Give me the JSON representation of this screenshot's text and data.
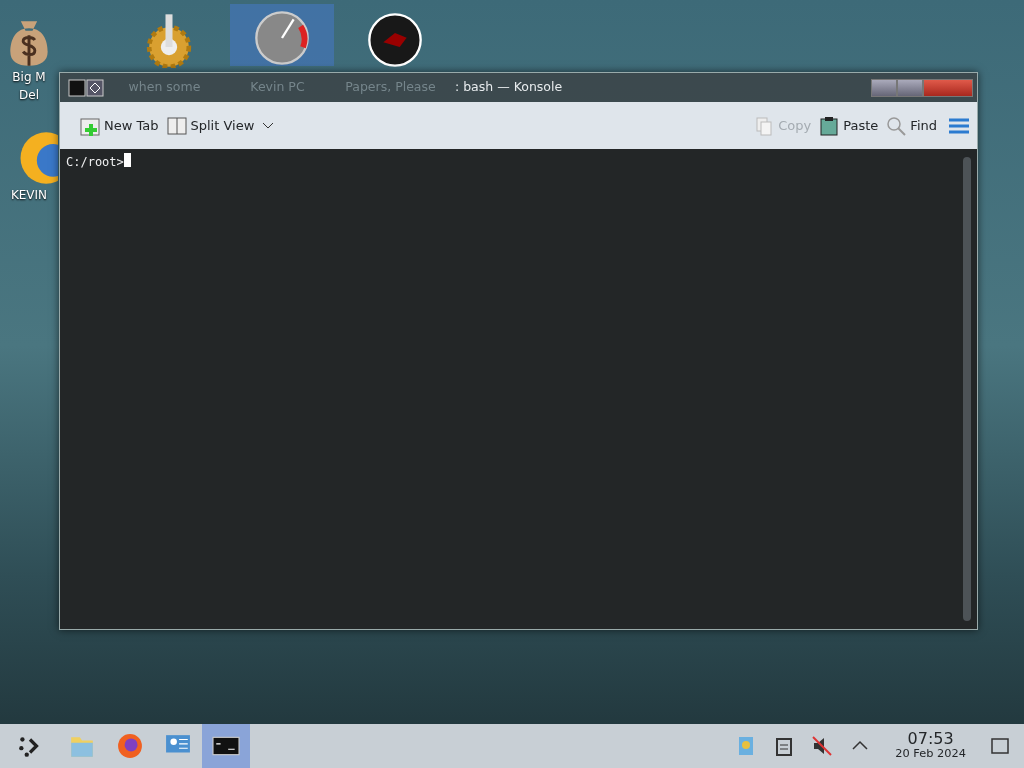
{
  "desktop_icons": [
    {
      "kind": "bag",
      "label": [
        "Big M",
        "Del"
      ],
      "selected": false
    },
    {
      "kind": "gear",
      "selected": false
    },
    {
      "kind": "gauge",
      "selected": true
    },
    {
      "kind": "disc",
      "selected": false
    },
    {
      "kind": "globe",
      "label": [
        "KEVIN"
      ],
      "selected": false
    }
  ],
  "window": {
    "ghost_labels": [
      "when some",
      "Kevin PC",
      "Papers, Please"
    ],
    "title": ": bash — Konsole",
    "toolbar": [
      {
        "kind": "newtab",
        "label": "New Tab",
        "disabled": false
      },
      {
        "kind": "split",
        "label": "Split View",
        "disabled": false
      },
      {
        "kind": "copy",
        "label": "Copy",
        "disabled": true
      },
      {
        "kind": "paste",
        "label": "Paste",
        "disabled": false
      },
      {
        "kind": "find",
        "label": "Find",
        "disabled": false
      }
    ],
    "terminal": {
      "prompt": "C:/root>"
    }
  },
  "taskbar": {
    "apps": [
      {
        "kind": "launcher",
        "selected": false
      },
      {
        "kind": "folder",
        "selected": false
      },
      {
        "kind": "browser",
        "selected": false
      },
      {
        "kind": "monitor",
        "selected": false
      },
      {
        "kind": "terminal",
        "selected": true
      }
    ],
    "tray": {
      "time": "07:53",
      "date": "20 Feb 2024"
    }
  }
}
